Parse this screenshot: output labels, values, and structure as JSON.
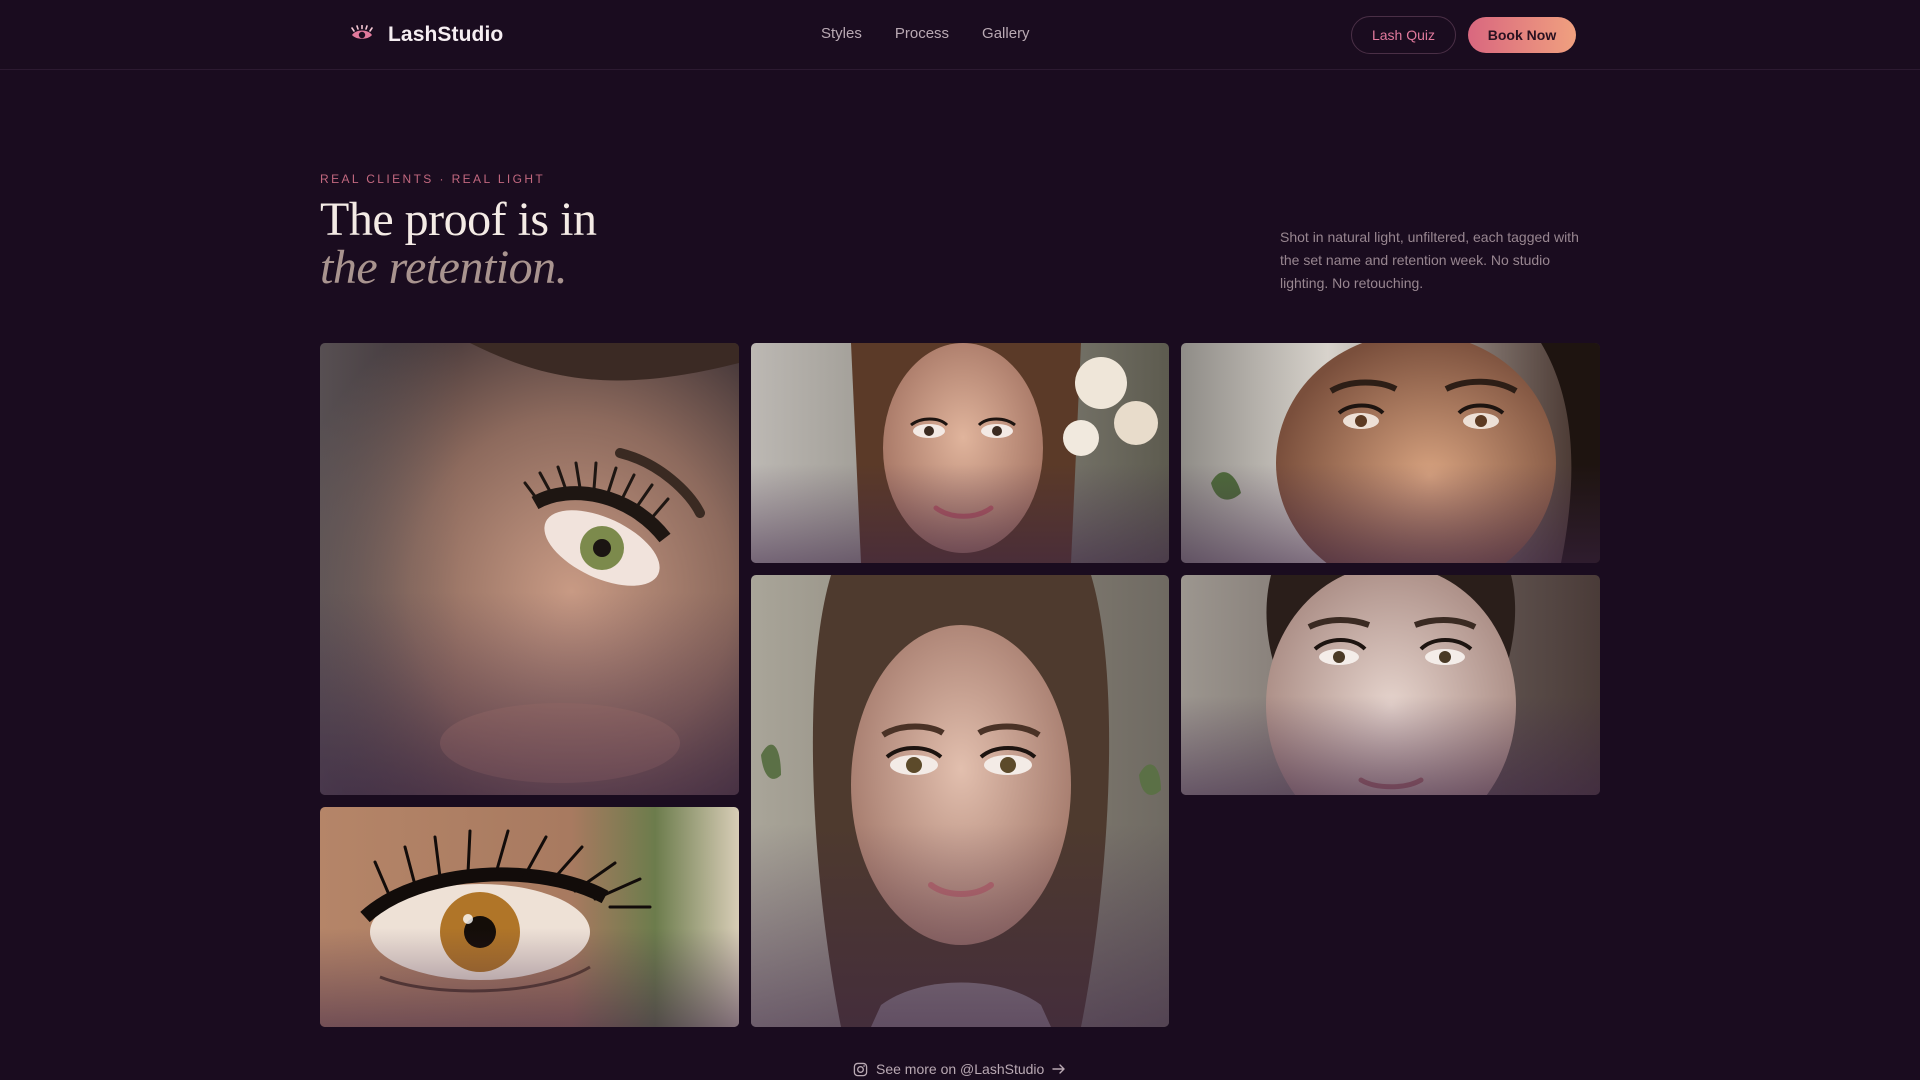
{
  "brand": {
    "name": "LashStudio",
    "icon": "lash-icon",
    "accent": "#e1799c"
  },
  "nav": {
    "items": [
      {
        "label": "Styles"
      },
      {
        "label": "Process"
      },
      {
        "label": "Gallery"
      }
    ]
  },
  "header": {
    "quiz_label": "Lash Quiz",
    "book_label": "Book Now"
  },
  "hero": {
    "eyebrow": "REAL CLIENTS · REAL LIGHT",
    "headline_line1": "The proof is in",
    "headline_line2": "the retention.",
    "intro": "Shot in natural light, unfiltered, each tagged with the set name and retention week. No studio lighting. No retouching."
  },
  "gallery": {
    "photos": [
      {
        "subject": "close-up eye with volume lash set"
      },
      {
        "subject": "bride smiling with classic lash set"
      },
      {
        "subject": "client in window light with hybrid lashes"
      },
      {
        "subject": "portrait of client with natural lash set"
      },
      {
        "subject": "client close-up with wispy lash set"
      },
      {
        "subject": "macro eye with mega volume lashes"
      }
    ]
  },
  "footer": {
    "more_label": "See more on @LashStudio",
    "more_icon": "instagram-icon",
    "arrow_icon": "arrow-right-icon"
  },
  "colors": {
    "background": "#1a0c1f",
    "accent_gradient_start": "#d9677f",
    "accent_gradient_end": "#f0a07f",
    "muted": "#988690"
  }
}
